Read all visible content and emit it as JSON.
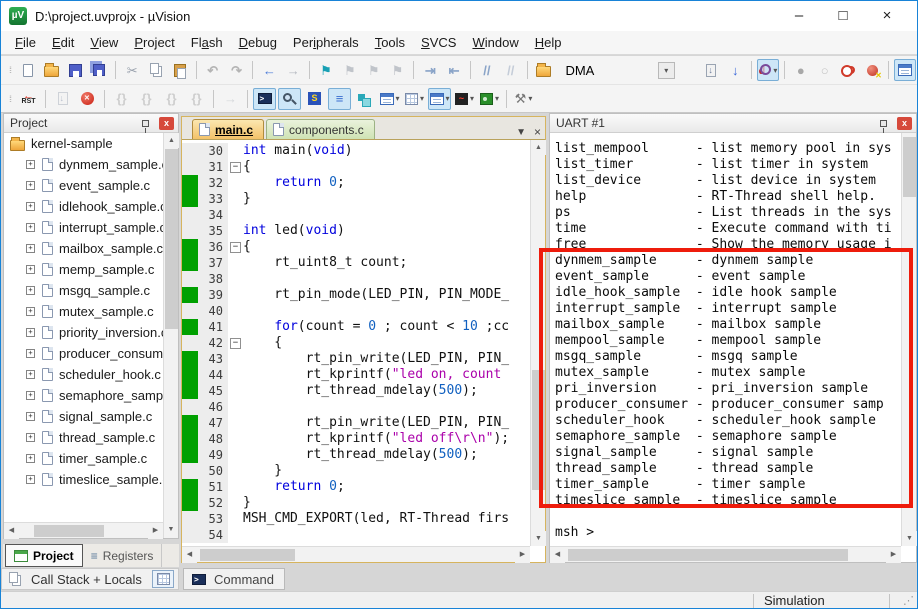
{
  "window": {
    "title": "D:\\project.uvprojx - µVision",
    "app_icon": "µV",
    "controls": {
      "minimize": "–",
      "maximize": "□",
      "close": "×"
    }
  },
  "menu": {
    "items": [
      {
        "label": "File",
        "u": 0
      },
      {
        "label": "Edit",
        "u": 0
      },
      {
        "label": "View",
        "u": 0
      },
      {
        "label": "Project",
        "u": 0
      },
      {
        "label": "Flash",
        "u": 2
      },
      {
        "label": "Debug",
        "u": 0
      },
      {
        "label": "Peripherals",
        "u": 3
      },
      {
        "label": "Tools",
        "u": 0
      },
      {
        "label": "SVCS",
        "u": 0
      },
      {
        "label": "Window",
        "u": 0
      },
      {
        "label": "Help",
        "u": 0
      }
    ]
  },
  "toolbar_main": {
    "target_combo_value": "DMA",
    "items": [
      {
        "n": "new-file",
        "c": "pg"
      },
      {
        "n": "open-file",
        "c": "fold"
      },
      {
        "n": "save",
        "c": "disk"
      },
      {
        "n": "save-all",
        "c": "disks"
      },
      {
        "sep": true
      },
      {
        "n": "cut",
        "g": "✂",
        "col": "#98a0ac"
      },
      {
        "n": "copy",
        "c": "copy"
      },
      {
        "n": "paste",
        "c": "paste"
      },
      {
        "sep": true
      },
      {
        "n": "undo",
        "g": "↶",
        "col": "#b4b4b4",
        "b": 1
      },
      {
        "n": "redo",
        "g": "↷",
        "col": "#b4b4b4",
        "b": 1
      },
      {
        "sep": true
      },
      {
        "n": "navigate-back",
        "g": "←",
        "col": "#4a7ad8",
        "b": 1
      },
      {
        "n": "navigate-forward",
        "g": "→",
        "col": "#b4b8c0",
        "b": 1
      },
      {
        "sep": true
      },
      {
        "n": "bookmark-toggle",
        "g": "⚑",
        "col": "#18a0b4"
      },
      {
        "n": "bookmark-next",
        "g": "⚑",
        "col": "#c0c4ca"
      },
      {
        "n": "bookmark-previous",
        "g": "⚑",
        "col": "#c0c4ca"
      },
      {
        "n": "bookmark-clear-all",
        "g": "⚑",
        "col": "#c0c4ca"
      },
      {
        "sep": true
      },
      {
        "n": "indent",
        "g": "⇥",
        "col": "#8aa4c8",
        "b": 1
      },
      {
        "n": "unindent",
        "g": "⇤",
        "col": "#8aa4c8",
        "b": 1
      },
      {
        "sep": true
      },
      {
        "n": "comment",
        "g": "//",
        "col": "#8aa4c8",
        "b": 1
      },
      {
        "n": "uncomment",
        "g": "//",
        "col": "#c4ccd8",
        "b": 1
      },
      {
        "sep": true
      },
      {
        "n": "target-options",
        "c": "fold"
      },
      {
        "combo": true
      },
      {
        "space": true
      },
      {
        "n": "translate-file",
        "c": "pgd"
      },
      {
        "n": "download-code",
        "g": "↓",
        "col": "#3a68d8",
        "b": 1
      },
      {
        "sep": true
      },
      {
        "n": "start-stop-debug",
        "c": "dbg",
        "g": "d",
        "hl": 1,
        "dd": 1
      },
      {
        "sep": true
      },
      {
        "n": "breakpoint-insert",
        "g": "●",
        "col": "#a8a8a8"
      },
      {
        "n": "breakpoint-enable-disable",
        "g": "○",
        "col": "#c4c4c4"
      },
      {
        "n": "breakpoint-disable-all",
        "c": "bp2"
      },
      {
        "n": "breakpoint-kill-all",
        "c": "bpk"
      },
      {
        "sep": true
      },
      {
        "n": "project-window",
        "c": "winb",
        "hl": 1
      }
    ]
  },
  "toolbar_debug": {
    "items": [
      {
        "n": "reset-cpu",
        "c": "rst",
        "g": "RST"
      },
      {
        "sep": true
      },
      {
        "n": "show-next-statement",
        "c": "pgd",
        "dis": 1
      },
      {
        "n": "stop-debug",
        "c": "stop"
      },
      {
        "sep": true
      },
      {
        "n": "step",
        "g": "{}",
        "col": "#9a9a9a",
        "b": 1,
        "dis": 1
      },
      {
        "n": "step-over",
        "g": "{}",
        "col": "#9a9a9a",
        "b": 1,
        "dis": 1
      },
      {
        "n": "step-out",
        "g": "{}",
        "col": "#9a9a9a",
        "b": 1,
        "dis": 1
      },
      {
        "n": "run-to-cursor",
        "g": "{}",
        "col": "#9a9a9a",
        "b": 1,
        "dis": 1
      },
      {
        "sep": true
      },
      {
        "n": "run",
        "g": "→",
        "col": "#a8b0b8",
        "b": 1,
        "dis": 1
      },
      {
        "sep": true
      },
      {
        "n": "command-window",
        "c": "cmd",
        "hl": 1
      },
      {
        "n": "disassembly-window",
        "c": "mag",
        "hl": 1
      },
      {
        "n": "symbol-window",
        "c": "sqs",
        "g": "S"
      },
      {
        "n": "registers-window",
        "g": "≡",
        "col": "#3a6fd0",
        "b": 1,
        "hl": 1
      },
      {
        "n": "call-stack-window",
        "c": "sym"
      },
      {
        "n": "watch-windows",
        "c": "winb",
        "dd": 1
      },
      {
        "n": "memory-windows",
        "c": "grid",
        "dd": 1
      },
      {
        "n": "serial-windows",
        "c": "winb",
        "hl": 1,
        "dd": 1
      },
      {
        "n": "analysis-windows",
        "c": "wave",
        "g": "~",
        "dd": 1
      },
      {
        "n": "system-viewer",
        "c": "sysv",
        "dd": 1
      },
      {
        "sep": true
      },
      {
        "n": "debug-toolbox",
        "g": "⚒",
        "col": "#777777",
        "dd": 1
      }
    ]
  },
  "project_panel": {
    "title": "Project",
    "root": "kernel-sample",
    "files": [
      "dynmem_sample.c",
      "event_sample.c",
      "idlehook_sample.c",
      "interrupt_sample.c",
      "mailbox_sample.c",
      "memp_sample.c",
      "msgq_sample.c",
      "mutex_sample.c",
      "priority_inversion.c",
      "producer_consumer.c",
      "scheduler_hook.c",
      "semaphore_sample.c",
      "signal_sample.c",
      "thread_sample.c",
      "timer_sample.c",
      "timeslice_sample.c"
    ]
  },
  "editor": {
    "tabs": [
      {
        "label": "main.c",
        "active": true
      },
      {
        "label": "components.c",
        "active": false
      }
    ],
    "lines": [
      {
        "n": 30,
        "t": [
          [
            "k",
            "int"
          ],
          [
            "p",
            " main("
          ],
          [
            "k",
            "void"
          ],
          [
            "p",
            ")"
          ]
        ]
      },
      {
        "n": 31,
        "f": 1,
        "t": [
          [
            "p",
            "{"
          ]
        ]
      },
      {
        "n": 32,
        "g": 1,
        "t": [
          [
            "p",
            "    "
          ],
          [
            "k",
            "return"
          ],
          [
            "p",
            " "
          ],
          [
            "n2",
            "0"
          ],
          [
            "p",
            ";"
          ]
        ]
      },
      {
        "n": 33,
        "g": 1,
        "t": [
          [
            "p",
            "}"
          ]
        ]
      },
      {
        "n": 34,
        "t": []
      },
      {
        "n": 35,
        "t": [
          [
            "k",
            "int"
          ],
          [
            "p",
            " led("
          ],
          [
            "k",
            "void"
          ],
          [
            "p",
            ")"
          ]
        ]
      },
      {
        "n": 36,
        "g": 1,
        "f": 1,
        "t": [
          [
            "p",
            "{"
          ]
        ]
      },
      {
        "n": 37,
        "g": 1,
        "t": [
          [
            "p",
            "    rt_uint8_t count;"
          ]
        ]
      },
      {
        "n": 38,
        "t": []
      },
      {
        "n": 39,
        "g": 1,
        "t": [
          [
            "p",
            "    rt_pin_mode(LED_PIN, PIN_MODE_"
          ]
        ]
      },
      {
        "n": 40,
        "t": []
      },
      {
        "n": 41,
        "g": 1,
        "t": [
          [
            "p",
            "    "
          ],
          [
            "k",
            "for"
          ],
          [
            "p",
            "(count = "
          ],
          [
            "n2",
            "0"
          ],
          [
            "p",
            " ; count < "
          ],
          [
            "n2",
            "10"
          ],
          [
            "p",
            " ;cc"
          ]
        ]
      },
      {
        "n": 42,
        "f": 1,
        "t": [
          [
            "p",
            "    {"
          ]
        ]
      },
      {
        "n": 43,
        "g": 1,
        "t": [
          [
            "p",
            "        rt_pin_write(LED_PIN, PIN_"
          ]
        ]
      },
      {
        "n": 44,
        "g": 1,
        "t": [
          [
            "p",
            "        rt_kprintf("
          ],
          [
            "s",
            "\"led on, count"
          ]
        ]
      },
      {
        "n": 45,
        "g": 1,
        "t": [
          [
            "p",
            "        rt_thread_mdelay("
          ],
          [
            "n2",
            "500"
          ],
          [
            "p",
            ");"
          ]
        ]
      },
      {
        "n": 46,
        "t": []
      },
      {
        "n": 47,
        "g": 1,
        "t": [
          [
            "p",
            "        rt_pin_write(LED_PIN, PIN_"
          ]
        ]
      },
      {
        "n": 48,
        "g": 1,
        "t": [
          [
            "p",
            "        rt_kprintf("
          ],
          [
            "s",
            "\"led off\\r\\n\""
          ],
          [
            "p",
            ");"
          ]
        ]
      },
      {
        "n": 49,
        "g": 1,
        "t": [
          [
            "p",
            "        rt_thread_mdelay("
          ],
          [
            "n2",
            "500"
          ],
          [
            "p",
            ");"
          ]
        ]
      },
      {
        "n": 50,
        "t": [
          [
            "p",
            "    }"
          ]
        ]
      },
      {
        "n": 51,
        "g": 1,
        "t": [
          [
            "p",
            "    "
          ],
          [
            "k",
            "return"
          ],
          [
            "p",
            " "
          ],
          [
            "n2",
            "0"
          ],
          [
            "p",
            ";"
          ]
        ]
      },
      {
        "n": 52,
        "g": 1,
        "t": [
          [
            "p",
            "}"
          ]
        ]
      },
      {
        "n": 53,
        "t": [
          [
            "p",
            "MSH_CMD_EXPORT(led, RT-Thread firs"
          ]
        ]
      },
      {
        "n": 54,
        "t": []
      }
    ]
  },
  "uart_panel": {
    "title": "UART #1",
    "lines": [
      "list_mempool      - list memory pool in sys",
      "list_timer        - list timer in system",
      "list_device       - list device in system",
      "help              - RT-Thread shell help.",
      "ps                - List threads in the sys",
      "time              - Execute command with ti",
      "free              - Show the memory usage i",
      "dynmem_sample     - dynmem sample",
      "event_sample      - event sample",
      "idle_hook_sample  - idle hook sample",
      "interrupt_sample  - interrupt sample",
      "mailbox_sample    - mailbox sample",
      "mempool_sample    - mempool sample",
      "msgq_sample       - msgq sample",
      "mutex_sample      - mutex sample",
      "pri_inversion     - pri_inversion sample",
      "producer_consumer - producer_consumer samp",
      "scheduler_hook    - scheduler_hook sample",
      "semaphore_sample  - semaphore sample",
      "signal_sample     - signal sample",
      "thread_sample     - thread sample",
      "timer_sample      - timer sample",
      "timeslice_sample  - timeslice sample",
      "",
      "msh >"
    ]
  },
  "bottom_left": {
    "tabs": [
      {
        "label": "Project",
        "active": true
      },
      {
        "label": "Registers",
        "active": false
      }
    ],
    "call_stack_label": "Call Stack + Locals"
  },
  "command_tab": {
    "label": "Command"
  },
  "status_bar": {
    "mode": "Simulation"
  },
  "colors": {
    "keyword": "#0000dd",
    "number": "#1060c0",
    "string": "#aa00aa",
    "coverage_green": "#00a000",
    "highlight_red": "#ee1c0c"
  }
}
